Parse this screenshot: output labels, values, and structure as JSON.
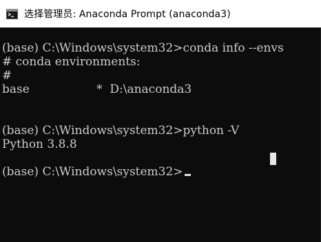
{
  "window": {
    "title": "选择管理员: Anaconda Prompt (anaconda3)"
  },
  "console": {
    "lines": [
      "(base) C:\\Windows\\system32>conda info --envs",
      "# conda environments:",
      "#",
      "base                  *  D:\\anaconda3",
      "",
      "",
      "(base) C:\\Windows\\system32>python -V",
      "Python 3.8.8",
      "",
      "(base) C:\\Windows\\system32>"
    ]
  },
  "colors": {
    "console_bg": "#0c0c0c",
    "console_fg": "#cccccc",
    "titlebar_bg": "#ffffff"
  },
  "icons": {
    "app": "terminal-icon"
  }
}
